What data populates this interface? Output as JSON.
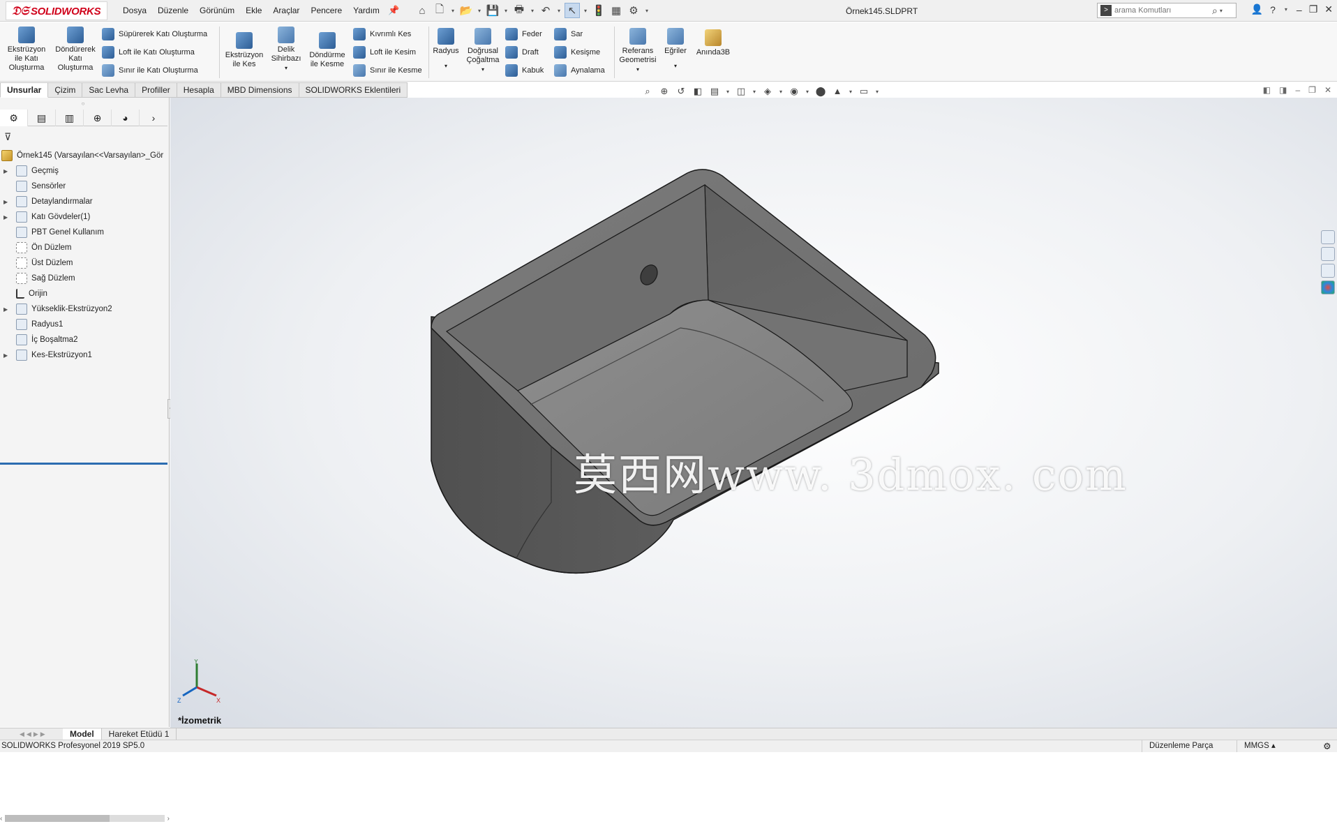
{
  "app": {
    "brand": "SOLIDWORKS",
    "document_title": "Örnek145.SLDPRT"
  },
  "menu": [
    "Dosya",
    "Düzenle",
    "Görünüm",
    "Ekle",
    "Araçlar",
    "Pencere",
    "Yardım"
  ],
  "search": {
    "placeholder": "arama Komutları"
  },
  "ribbon": {
    "features": {
      "extrude_boss": "Ekstrüzyon ile Katı Oluşturma",
      "revolve_boss": "Döndürerek Katı Oluşturma",
      "sweep_boss": "Süpürerek Katı Oluşturma",
      "loft_boss": "Loft ile Katı Oluşturma",
      "boundary_boss": "Sınır ile Katı Oluşturma",
      "extrude_cut": "Ekstrüzyon ile Kes",
      "hole_wizard": "Delik Sihirbazı",
      "revolve_cut": "Döndürme ile Kesme",
      "swept_cut": "Kıvrımlı Kes",
      "loft_cut": "Loft ile Kesim",
      "boundary_cut": "Sınır ile Kesme",
      "fillet": "Radyus",
      "linear_pattern": "Doğrusal Çoğaltma",
      "rib": "Feder",
      "draft": "Draft",
      "shell": "Kabuk",
      "wrap": "Sar",
      "intersect": "Kesişme",
      "mirror": "Aynalama",
      "ref_geometry": "Referans Geometrisi",
      "curves": "Eğriler",
      "instant3d": "Anında3B"
    }
  },
  "tabs": [
    "Unsurlar",
    "Çizim",
    "Sac Levha",
    "Profiller",
    "Hesapla",
    "MBD Dimensions",
    "SOLIDWORKS Eklentileri"
  ],
  "tree": {
    "root": "Örnek145  (Varsayılan<<Varsayılan>_Gör",
    "items": [
      {
        "label": "Geçmiş",
        "expandable": true
      },
      {
        "label": "Sensörler",
        "expandable": false
      },
      {
        "label": "Detaylandırmalar",
        "expandable": true
      },
      {
        "label": "Katı Gövdeler(1)",
        "expandable": true
      },
      {
        "label": "PBT Genel Kullanım",
        "expandable": false
      },
      {
        "label": "Ön Düzlem",
        "expandable": false
      },
      {
        "label": "Üst Düzlem",
        "expandable": false
      },
      {
        "label": "Sağ Düzlem",
        "expandable": false
      },
      {
        "label": "Orijin",
        "expandable": false
      },
      {
        "label": "Yükseklik-Ekstrüzyon2",
        "expandable": true
      },
      {
        "label": "Radyus1",
        "expandable": false
      },
      {
        "label": "İç Boşaltma2",
        "expandable": false
      },
      {
        "label": "Kes-Ekstrüzyon1",
        "expandable": true
      }
    ]
  },
  "viewport": {
    "view_name": "*İzometrik",
    "watermark": "莫西网www. 3dmox. com",
    "triad": {
      "x": "X",
      "y": "Y",
      "z": "Z"
    }
  },
  "bottom_tabs": [
    "Model",
    "Hareket Etüdü 1"
  ],
  "status": {
    "product": "SOLIDWORKS Profesyonel 2019 SP5.0",
    "mode": "Düzenleme Parça",
    "units": "MMGS"
  },
  "colors": {
    "brand_red": "#d0021b",
    "model_gray": "#6b6b6b",
    "selection_blue": "#2b6cb0"
  }
}
